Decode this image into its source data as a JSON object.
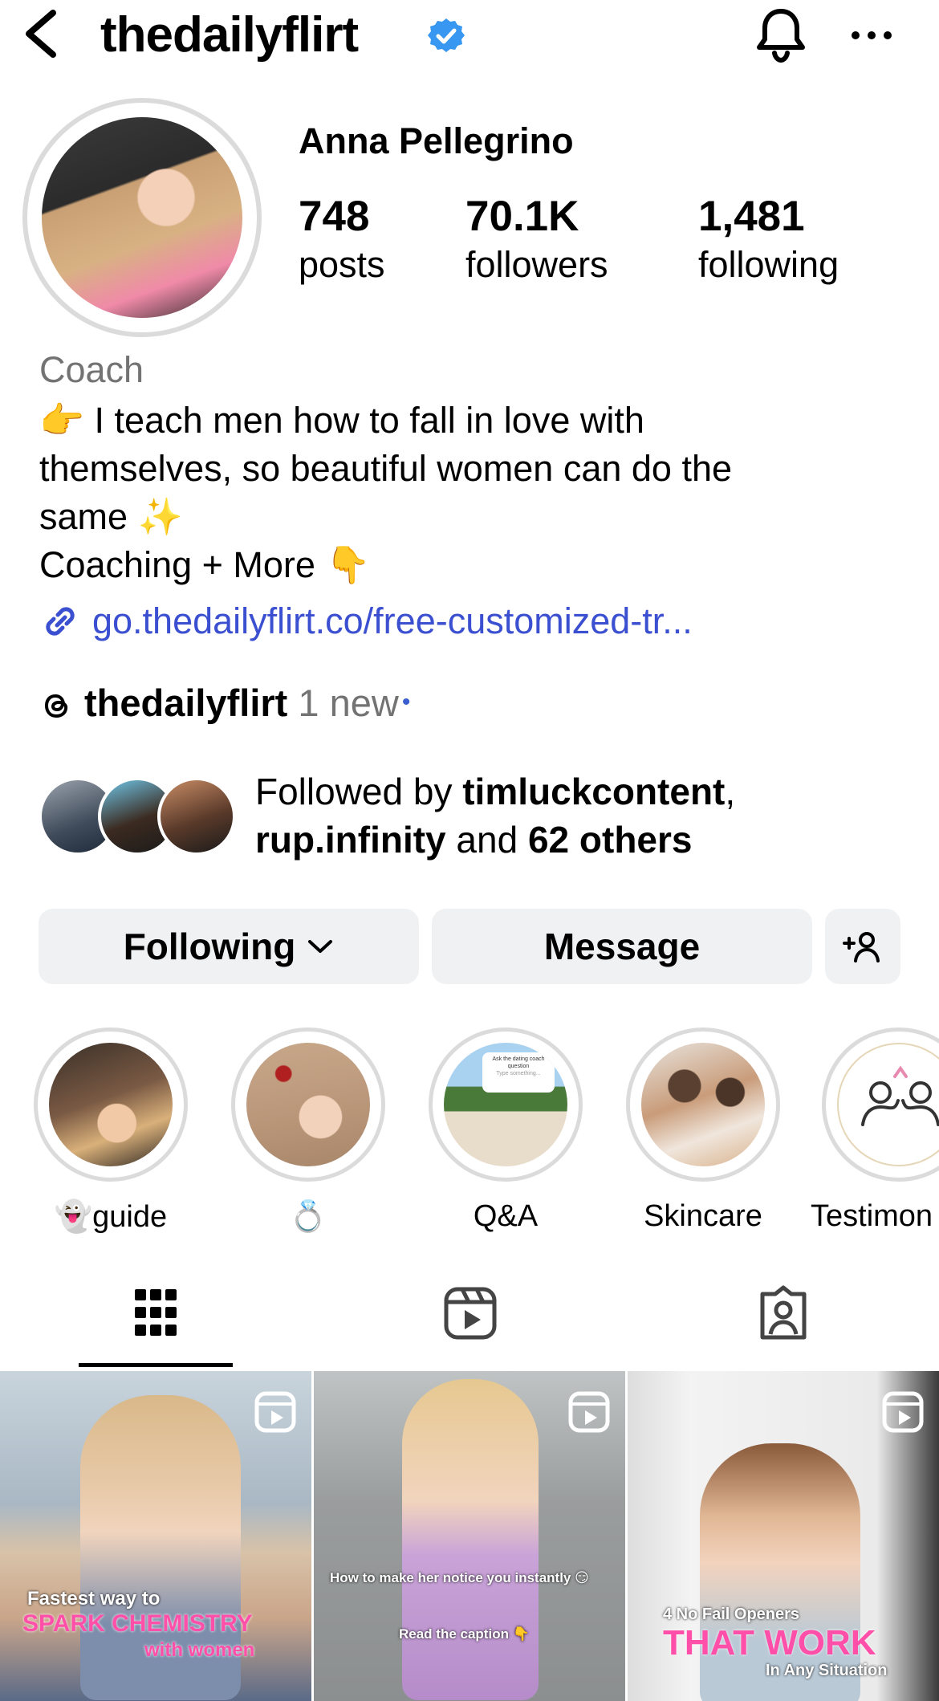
{
  "header": {
    "username": "thedailyflirt",
    "icons": {
      "back": "back-chevron-icon",
      "verified": "verified-badge-icon",
      "notifications": "bell-icon",
      "more": "more-horizontal-icon"
    }
  },
  "profile": {
    "full_name": "Anna Pellegrino",
    "stats": [
      {
        "value": "748",
        "label": "posts"
      },
      {
        "value": "70.1K",
        "label": "followers"
      },
      {
        "value": "1,481",
        "label": "following"
      }
    ],
    "category": "Coach",
    "bio_lines": [
      "👉 I teach men how to fall in love with",
      "themselves, so beautiful women can do the",
      "same ✨",
      "Coaching + More  👇"
    ],
    "link": "go.thedailyflirt.co/free-customized-tr...",
    "threads": {
      "handle": "thedailyflirt",
      "badge": "1 new",
      "dot": "•"
    },
    "followed_by": {
      "prefix": "Followed by ",
      "user1": "timluckcontent",
      "sep": ",",
      "user2": "rup.infinity",
      "mid": " and ",
      "others": "62 others"
    }
  },
  "actions": {
    "following": "Following",
    "message": "Message",
    "suggest_icon": "add-person-icon"
  },
  "highlights": [
    {
      "label": "👻guide"
    },
    {
      "label": "💍"
    },
    {
      "label": "Q&A"
    },
    {
      "label": "Skincare"
    },
    {
      "label": "Testimon"
    }
  ],
  "highlight_overlay": {
    "line1": "Ask the dating coach",
    "line2": "question",
    "line3": "Type something..."
  },
  "tabs": [
    {
      "name": "posts-grid-tab",
      "icon": "grid-icon",
      "active": true
    },
    {
      "name": "reels-tab",
      "icon": "reels-icon",
      "active": false
    },
    {
      "name": "tagged-tab",
      "icon": "tagged-person-icon",
      "active": false
    }
  ],
  "grid": [
    {
      "caption1": "Fastest way to",
      "caption2": "SPARK CHEMISTRY",
      "caption3": "with women"
    },
    {
      "caption1": "How to make her notice you instantly 😏",
      "caption2": "Read the caption 👇"
    },
    {
      "caption1": "4 No Fail Openers",
      "caption2": "THAT WORK",
      "caption3": "In Any Situation"
    }
  ],
  "colors": {
    "accent_blue": "#3b4fd1",
    "verified_blue": "#3897f0",
    "button_bg": "#eff1f3",
    "ring_gray": "#dbdbdb",
    "muted": "#737373",
    "caption_pink": "#ff4fa8"
  }
}
